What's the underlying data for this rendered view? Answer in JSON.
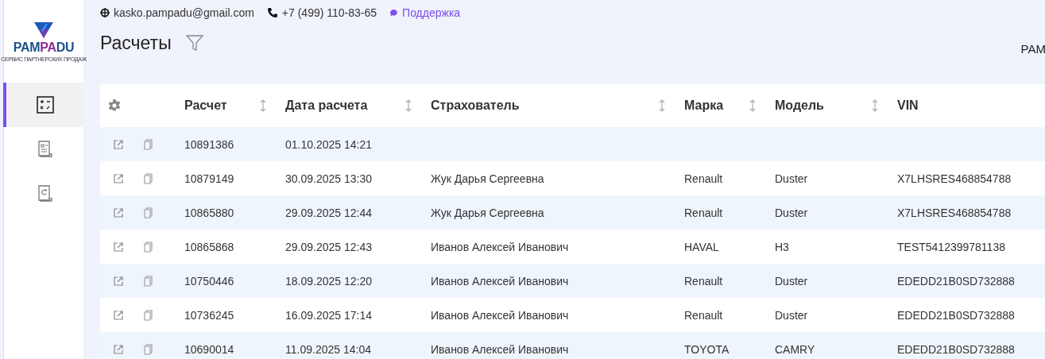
{
  "logo": {
    "name_parts": [
      "PAM",
      "PA",
      "DU"
    ],
    "tagline": "СЕРВИС ПАРТНЕРСКИХ ПРОДАЖ"
  },
  "sidebar": {
    "items": [
      {
        "selected": true
      },
      {
        "selected": false
      },
      {
        "selected": false
      }
    ]
  },
  "header": {
    "email": "kasko.pampadu@gmail.com",
    "phone": "+7 (499) 110-83-65",
    "support": "Поддержка"
  },
  "page": {
    "title": "Расчеты",
    "right_text": "PAM"
  },
  "table": {
    "columns": [
      {
        "label": "Расчет",
        "sortable": true
      },
      {
        "label": "Дата расчета",
        "sortable": true
      },
      {
        "label": "Страхователь",
        "sortable": true
      },
      {
        "label": "Марка",
        "sortable": true
      },
      {
        "label": "Модель",
        "sortable": true
      },
      {
        "label": "VIN",
        "sortable": false
      }
    ],
    "rows": [
      {
        "cells": [
          "10891386",
          "01.10.2025 14:21"
        ]
      },
      {
        "cells": [
          "10879149",
          "30.09.2025 13:30",
          "Жук Дарья Сергеевна",
          "Renault",
          "Duster",
          "X7LHSRES468854788"
        ]
      },
      {
        "cells": [
          "10865880",
          "29.09.2025 12:44",
          "Жук Дарья Сергеевна",
          "Renault",
          "Duster",
          "X7LHSRES468854788"
        ]
      },
      {
        "cells": [
          "10865868",
          "29.09.2025 12:43",
          "Иванов Алексей Иванович",
          "HAVAL",
          "H3",
          "TEST5412399781138"
        ]
      },
      {
        "cells": [
          "10750446",
          "18.09.2025 12:20",
          "Иванов Алексей Иванович",
          "Renault",
          "Duster",
          "EDEDD21B0SD732888"
        ]
      },
      {
        "cells": [
          "10736245",
          "16.09.2025 17:14",
          "Иванов Алексей Иванович",
          "Renault",
          "Duster",
          "EDEDD21B0SD732888"
        ]
      },
      {
        "cells": [
          "10690014",
          "11.09.2025 14:04",
          "Иванов Алексей Иванович",
          "TOYOTA",
          "CAMRY",
          "EDEDD21B0SD732888"
        ]
      }
    ]
  }
}
